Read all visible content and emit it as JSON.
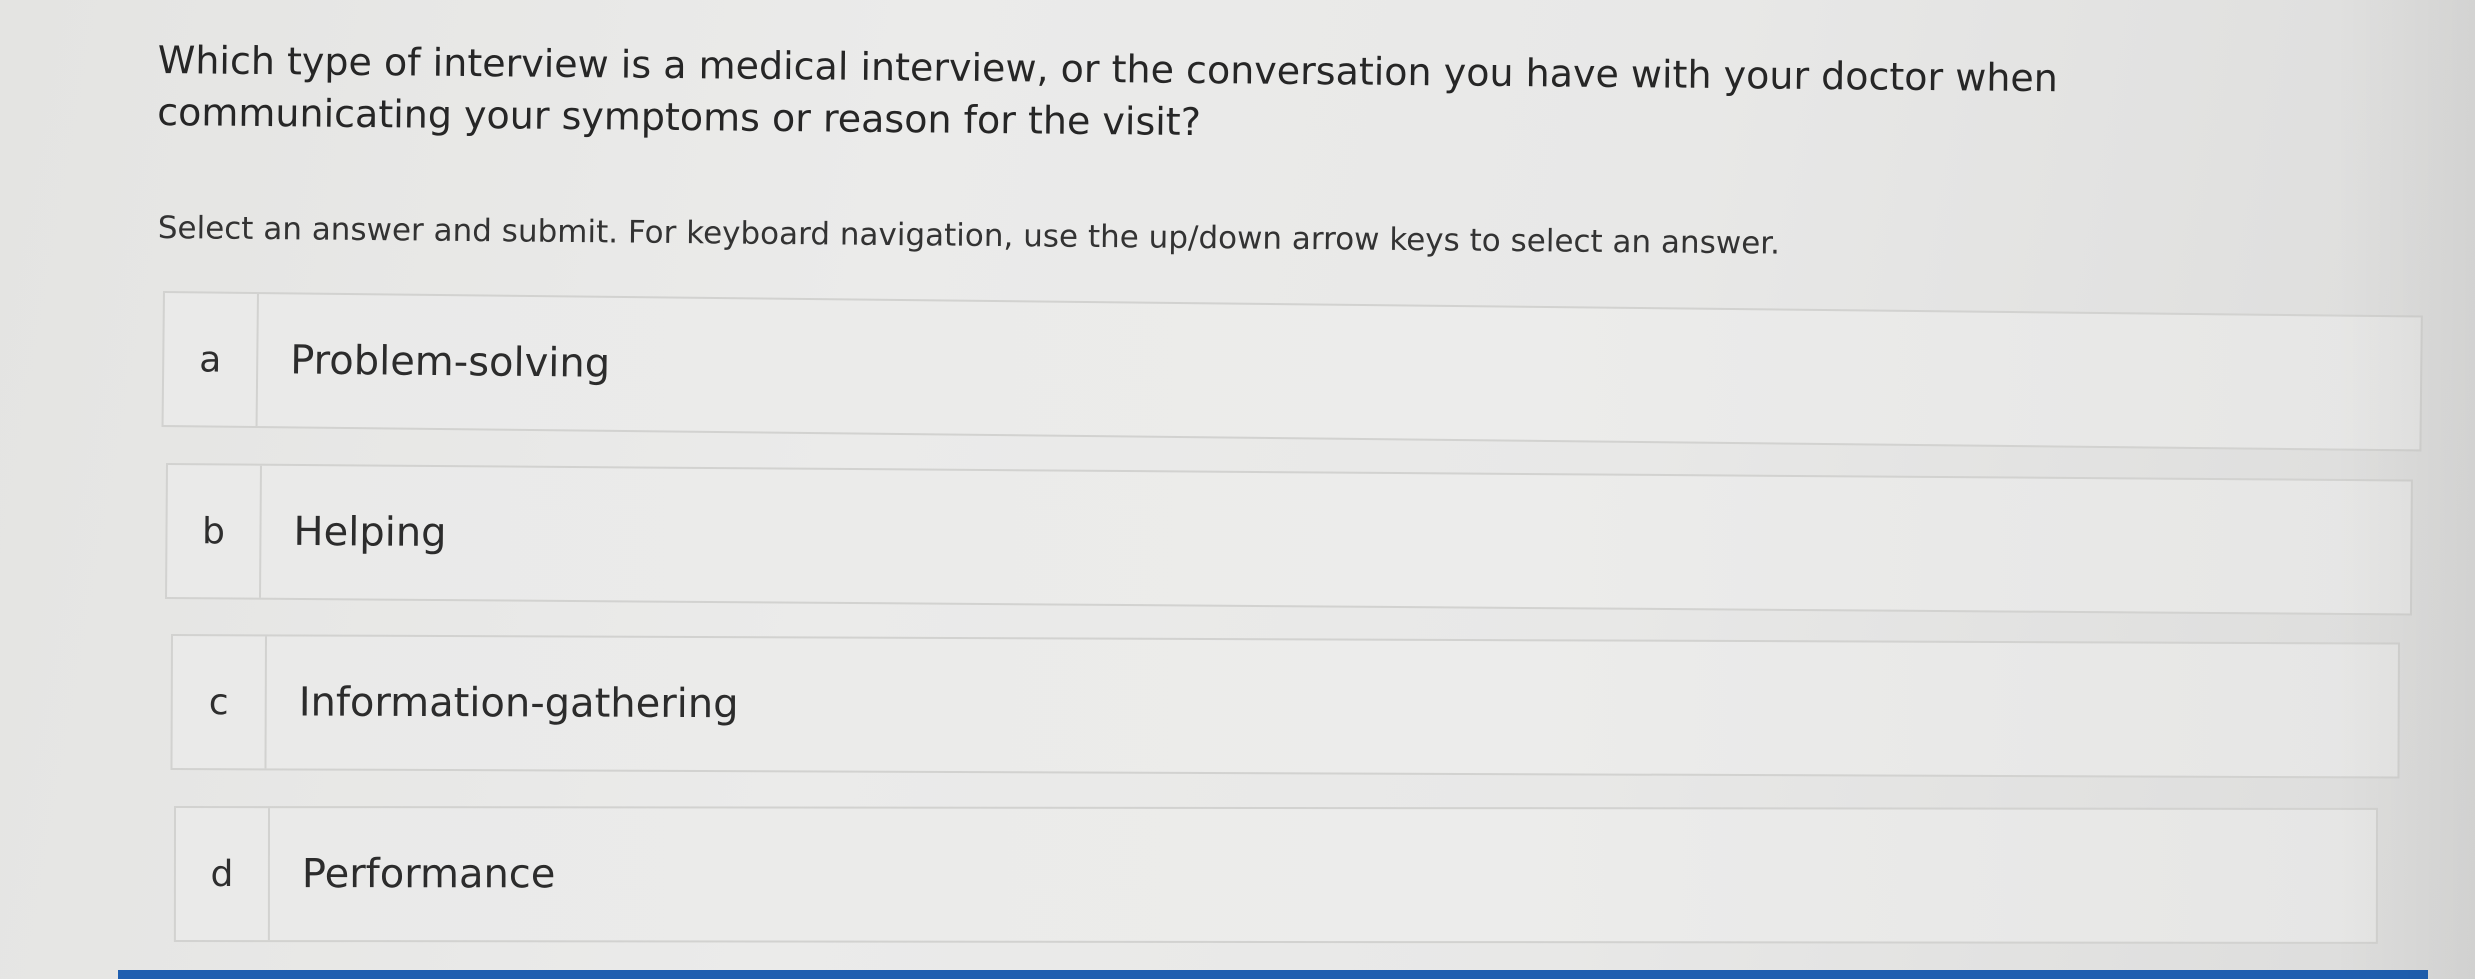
{
  "question": {
    "text": "Which type of interview is a medical interview, or the conversation you have with your doctor when communicating your symptoms or reason for the visit?",
    "instructions": "Select an answer and submit. For keyboard navigation, use the up/down arrow keys to select an answer."
  },
  "options": [
    {
      "letter": "a",
      "label": "Problem-solving"
    },
    {
      "letter": "b",
      "label": "Helping"
    },
    {
      "letter": "c",
      "label": "Information-gathering"
    },
    {
      "letter": "d",
      "label": "Performance"
    }
  ],
  "colors": {
    "accent_bar": "#1f5fb0",
    "background": "#e8e8e7",
    "border": "#d2d2d0"
  }
}
